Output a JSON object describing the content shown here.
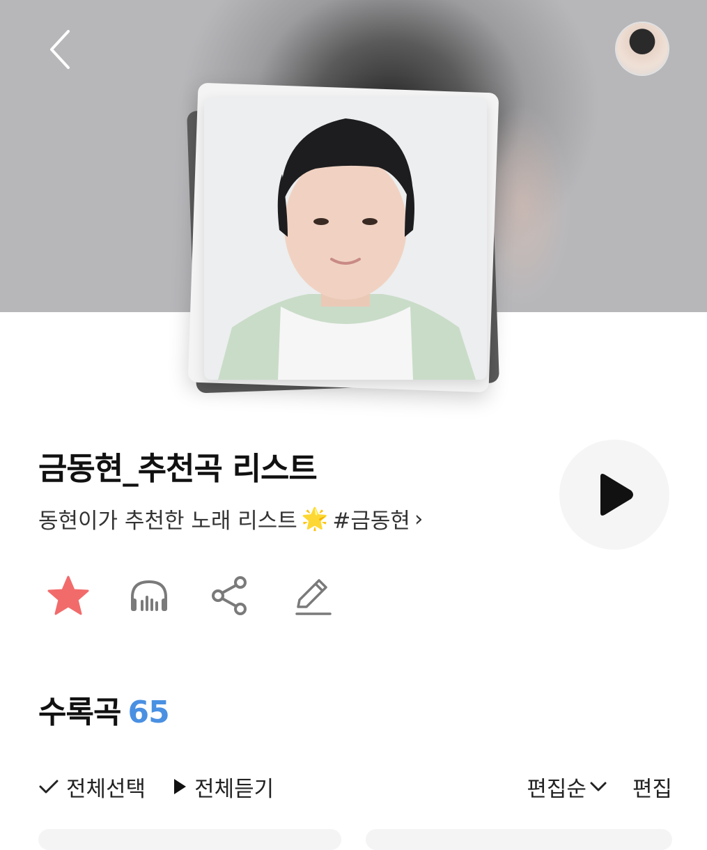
{
  "header": {
    "back_icon": "chevron-left-icon",
    "avatar_icon": "user-avatar"
  },
  "playlist": {
    "title": "금동현_추천곡 리스트",
    "description": "동현이가 추천한 노래 리스트",
    "description_emoji": "🌟",
    "hashtag": "#금동현",
    "chevron": "›"
  },
  "actions": [
    {
      "name": "favorite",
      "icon": "star-icon",
      "color": "#f26b6b"
    },
    {
      "name": "listen",
      "icon": "headphones-icon",
      "color": "#7a7a7a"
    },
    {
      "name": "share",
      "icon": "share-icon",
      "color": "#7a7a7a"
    },
    {
      "name": "edit",
      "icon": "pencil-icon",
      "color": "#7a7a7a"
    }
  ],
  "tracks_section": {
    "title": "수록곡",
    "count": "65"
  },
  "toolbar": {
    "select_all": "전체선택",
    "play_all": "전체듣기",
    "sort": "편집순",
    "edit": "편집"
  },
  "colors": {
    "accent": "#4a90e2",
    "star": "#f26b6b",
    "icon_gray": "#7a7a7a"
  }
}
